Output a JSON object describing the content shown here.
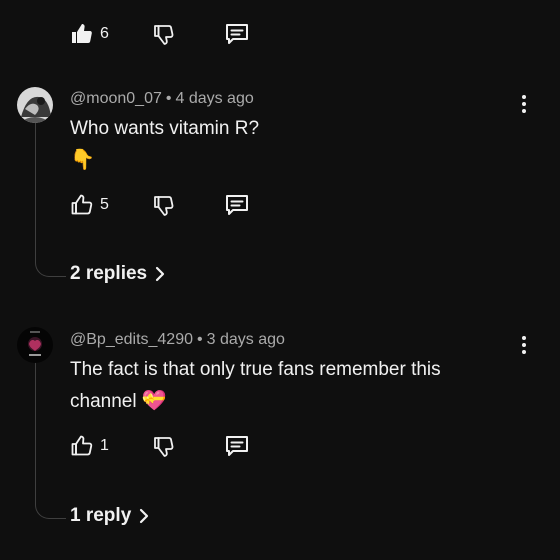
{
  "top_actions": {
    "like_count": "6"
  },
  "comments": [
    {
      "username": "@moon0_07",
      "separator": "•",
      "age": "4 days ago",
      "text_line1": "Who wants vitamin R?",
      "emoji": "👇",
      "like_count": "5",
      "replies_label": "2 replies"
    },
    {
      "username": "@Bp_edits_4290",
      "separator": "•",
      "age": "3 days ago",
      "text_line1": "The fact is that only true fans remember this",
      "text_line2": "channel",
      "emoji": "💝",
      "like_count": "1",
      "replies_label": "1 reply"
    }
  ],
  "icons": {
    "like": "thumbs-up-icon",
    "dislike": "thumbs-down-icon",
    "reply": "reply-comment-icon",
    "more": "more-vertical-icon",
    "chevron": "chevron-right-icon"
  },
  "colors": {
    "background": "#0f0f0f",
    "text": "#f1f1f1",
    "meta": "#aaaaaa",
    "thread": "#3f3f3f"
  }
}
